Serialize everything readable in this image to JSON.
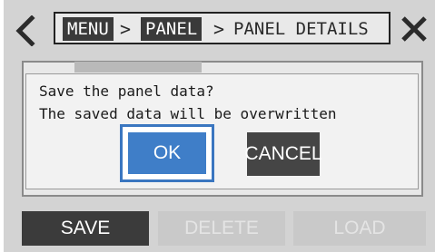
{
  "breadcrumb": {
    "items": [
      "MENU",
      "PANEL",
      "PANEL DETAILS"
    ],
    "separator": ">"
  },
  "icons": {
    "back": "chevron-left-icon",
    "close": "close-x-icon"
  },
  "dialog": {
    "line1": "Save the panel data?",
    "line2": "The saved data will be overwritten",
    "ok_label": "OK",
    "cancel_label": "CANCEL"
  },
  "actions": {
    "save_label": "SAVE",
    "delete_label": "DELETE",
    "load_label": "LOAD"
  },
  "colors": {
    "accent": "#3f7ec8",
    "focus_ring": "#3a76c0",
    "dark_button": "#3b3b3b",
    "disabled_button": "#c9c9c9"
  }
}
